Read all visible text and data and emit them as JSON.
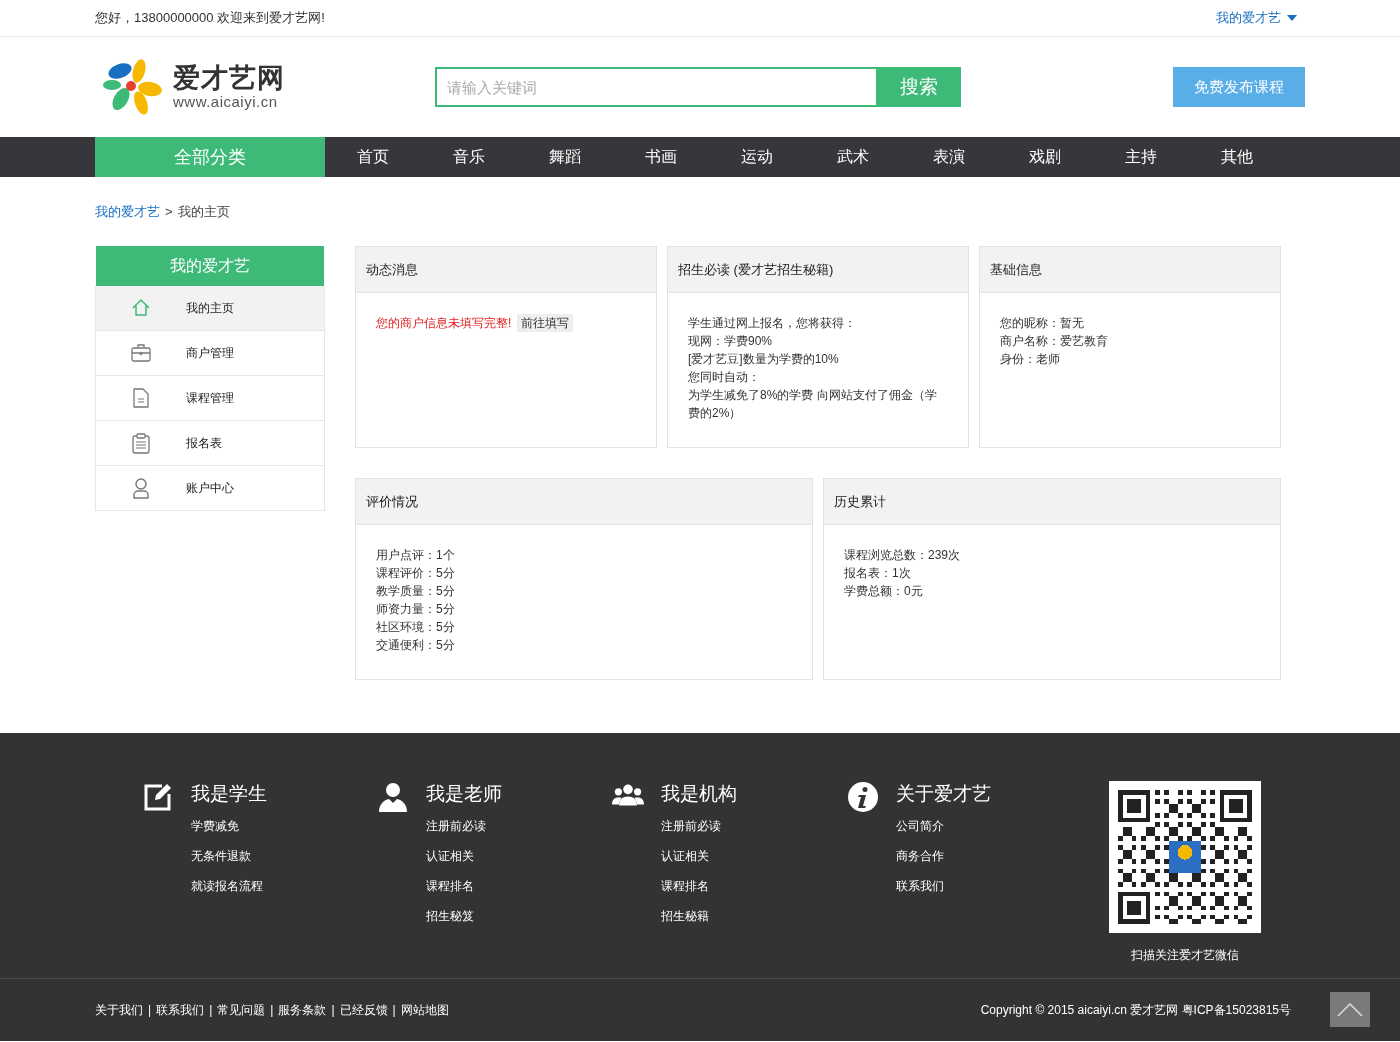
{
  "top_bar": {
    "greeting": "您好，13800000000 欢迎来到爱才艺网!",
    "user_menu": "我的爱才艺"
  },
  "header": {
    "logo_name": "爱才艺网",
    "logo_url": "www.aicaiyi.cn",
    "search_placeholder": "请输入关键词",
    "search_button": "搜索",
    "publish_button": "免费发布课程"
  },
  "nav": {
    "all_categories": "全部分类",
    "items": [
      "首页",
      "音乐",
      "舞蹈",
      "书画",
      "运动",
      "武术",
      "表演",
      "戏剧",
      "主持",
      "其他"
    ]
  },
  "breadcrumb": {
    "link": "我的爱才艺",
    "separator": ">",
    "current": "我的主页"
  },
  "sidebar": {
    "title": "我的爱才艺",
    "items": [
      {
        "label": "我的主页",
        "kind": "home",
        "selected": true
      },
      {
        "label": "商户管理",
        "kind": "briefcase",
        "selected": false
      },
      {
        "label": "课程管理",
        "kind": "document",
        "selected": false
      },
      {
        "label": "报名表",
        "kind": "clipboard",
        "selected": false
      },
      {
        "label": "账户中心",
        "kind": "user",
        "selected": false
      }
    ]
  },
  "cards_row_1": [
    {
      "title": "动态消息",
      "kind": "notice",
      "notice": "您的商户信息未填写完整!",
      "action": "前往填写"
    },
    {
      "title": "招生必读 (爱才艺招生秘籍)",
      "kind": "lines",
      "lines": [
        "学生通过网上报名，您将获得：",
        "现网：学费90%",
        "[爱才艺豆]数量为学费的10%",
        "您同时自动：",
        "为学生减免了8%的学费 向网站支付了佣金（学费的2%）"
      ]
    },
    {
      "title": "基础信息",
      "kind": "lines",
      "lines": [
        "您的昵称：暂无",
        "商户名称：爱艺教育",
        "身份：老师"
      ]
    }
  ],
  "cards_row_2": [
    {
      "title": "评价情况",
      "kind": "lines",
      "lines": [
        "用户点评：1个",
        "课程评价：5分",
        "教学质量：5分",
        "师资力量：5分",
        "社区环境：5分",
        "交通便利：5分"
      ]
    },
    {
      "title": "历史累计",
      "kind": "lines",
      "lines": [
        "课程浏览总数：239次",
        "报名表：1次",
        "学费总额：0元"
      ]
    }
  ],
  "footer": {
    "columns": [
      {
        "title": "我是学生",
        "kind": "edit",
        "links": [
          "学费减免",
          "无条件退款",
          "就读报名流程"
        ]
      },
      {
        "title": "我是老师",
        "kind": "person",
        "links": [
          "注册前必读",
          "认证相关",
          "课程排名",
          "招生秘笈"
        ]
      },
      {
        "title": "我是机构",
        "kind": "group",
        "links": [
          "注册前必读",
          "认证相关",
          "课程排名",
          "招生秘籍"
        ]
      },
      {
        "title": "关于爱才艺",
        "kind": "info",
        "links": [
          "公司简介",
          "商务合作",
          "联系我们"
        ]
      }
    ],
    "qr_caption": "扫描关注爱才艺微信",
    "bottom_links": [
      "关于我们",
      "联系我们",
      "常见问题",
      "服务条款",
      "已经反馈",
      "网站地图"
    ],
    "separator": "|",
    "copyright": "Copyright © 2015 aicaiyi.cn 爱才艺网 粤ICP备15023815号"
  }
}
